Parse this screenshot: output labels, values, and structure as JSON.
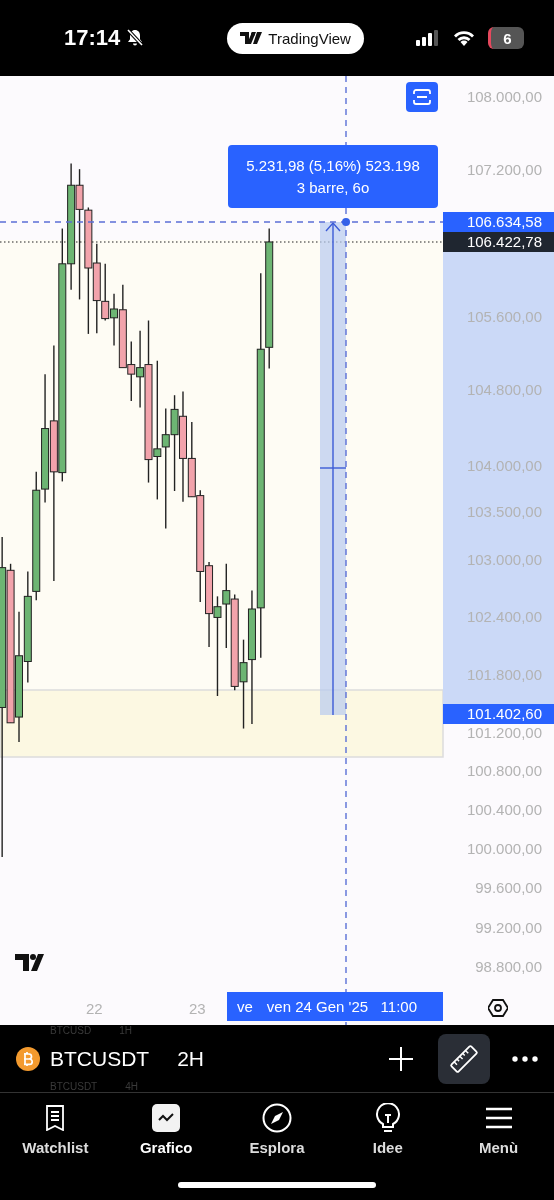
{
  "status_bar": {
    "time": "17:14",
    "app_badge": "TradingView",
    "battery": "6"
  },
  "chart": {
    "price_labels": [
      "108.000,00",
      "107.200,00",
      "105.600,00",
      "104.800,00",
      "104.000,00",
      "103.500,00",
      "103.000,00",
      "102.400,00",
      "101.800,00",
      "101.200,00",
      "100.800,00",
      "100.400,00",
      "100.000,00",
      "99.600,00",
      "99.200,00",
      "98.800,00"
    ],
    "price_tags": [
      {
        "text": "106.634,58",
        "kind": "measure"
      },
      {
        "text": "106.422,78",
        "kind": "last"
      },
      {
        "text": "101.402,60",
        "kind": "measure"
      }
    ],
    "measure_tooltip": {
      "line_1": "5.231,98 (5,16%) 523.198",
      "line_2": "3 barre, 6o"
    },
    "time_labels": [
      "22",
      "23"
    ],
    "crosshair_time": {
      "cut_label": "ve",
      "label": "ven 24 Gen '25   11:00"
    }
  },
  "symbol_bar": {
    "symbol": "BTCUSDT",
    "interval": "2H",
    "picker_above": {
      "symbol": "BTCUSD",
      "interval": "1H"
    },
    "picker_below": {
      "symbol": "BTCUSDT",
      "interval": "4H"
    },
    "ruler_active": true
  },
  "tabs": [
    {
      "label": "Watchlist",
      "selected": false
    },
    {
      "label": "Grafico",
      "selected": true
    },
    {
      "label": "Esplora",
      "selected": false
    },
    {
      "label": "Idee",
      "selected": false
    },
    {
      "label": "Menù",
      "selected": false
    }
  ]
}
